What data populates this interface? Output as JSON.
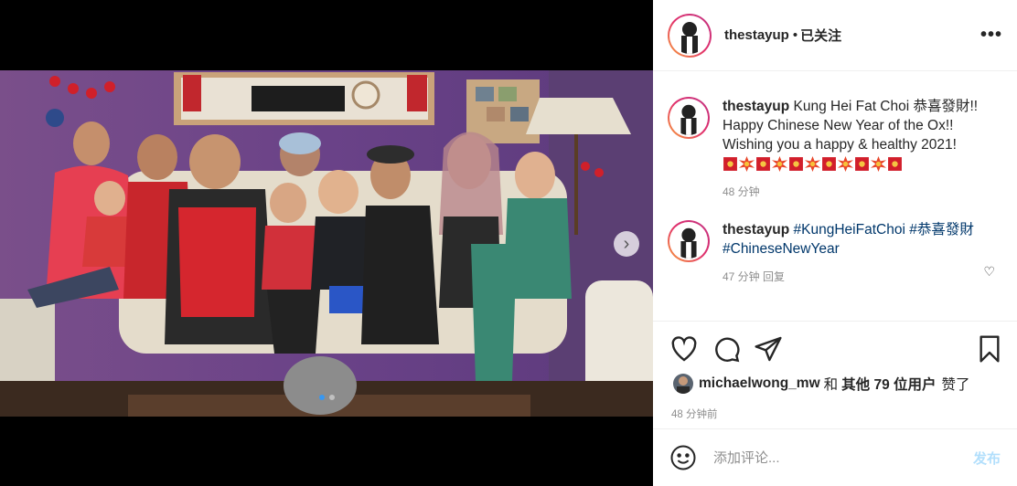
{
  "post": {
    "username": "thestayup",
    "separator": "•",
    "follow_status": "已关注",
    "more_icon": "more-horizontal-icon"
  },
  "caption": {
    "author": "thestayup",
    "line1": "Kung Hei Fat Choi 恭喜發財!!",
    "line2": "Happy Chinese New Year of the Ox!!",
    "line3": "Wishing you a happy & healthy 2021!",
    "emojis": [
      "red-envelope",
      "collision",
      "red-envelope",
      "collision",
      "red-envelope",
      "collision",
      "red-envelope",
      "collision",
      "red-envelope",
      "collision",
      "red-envelope"
    ],
    "time": "48 分钟"
  },
  "comment": {
    "author": "thestayup",
    "tag1": "#KungHeiFatChoi",
    "tag2": "#恭喜發財",
    "tag3": "#ChineseNewYear",
    "partial_meta": "47 分钟 回复"
  },
  "actions": {
    "like_icon": "heart-icon",
    "comment_icon": "comment-icon",
    "share_icon": "share-icon",
    "save_icon": "bookmark-icon"
  },
  "likes": {
    "user": "michaelwong_mw",
    "and": "和",
    "others": "其他 79 位用户",
    "suffix": "赞了"
  },
  "timestamp": "48 分钟前",
  "add_comment": {
    "placeholder": "添加评论...",
    "post_label": "发布",
    "emoji_icon": "smiley-icon"
  },
  "carousel": {
    "next_icon": "chevron-right-icon",
    "total": 2,
    "current": 1
  }
}
